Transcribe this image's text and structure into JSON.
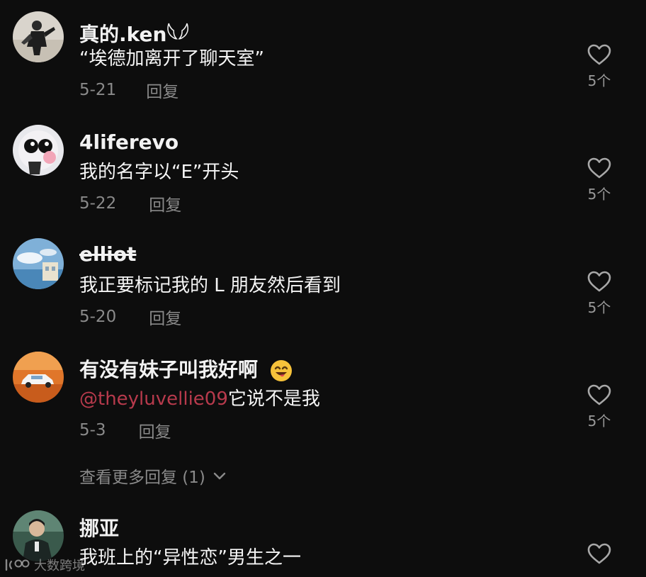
{
  "comments": [
    {
      "username": "真的.ken𓆩𓆪",
      "text": "“埃德加离开了聊天室”",
      "date": "5-21",
      "reply_label": "回复",
      "likes": "5个",
      "avatar_icon": "avatar-dancer-icon"
    },
    {
      "username": "4liferevo",
      "text": "我的名字以“E”开头",
      "date": "5-22",
      "reply_label": "回复",
      "likes": "5个",
      "avatar_icon": "avatar-cartoon-icon"
    },
    {
      "username": "elliot",
      "text": "我正要标记我的 L 朋友然后看到",
      "date": "5-20",
      "reply_label": "回复",
      "likes": "5个",
      "avatar_icon": "avatar-sky-icon"
    },
    {
      "username": "有没有妹子叫我好啊",
      "mention": "@theyluvellie09",
      "text": "它说不是我",
      "date": "5-3",
      "reply_label": "回复",
      "likes": "5个",
      "avatar_icon": "avatar-car-icon"
    },
    {
      "username": "挪亚",
      "text": "我班上的“异性恋”男生之一",
      "avatar_icon": "avatar-person-icon"
    }
  ],
  "view_more": {
    "label": "查看更多回复 (1)"
  },
  "watermark": {
    "text": "大数跨境"
  },
  "colors": {
    "background": "#0d0d0d",
    "username": "#f2f2f2",
    "meta": "#8a8a8a",
    "mention": "#b73a4c"
  }
}
